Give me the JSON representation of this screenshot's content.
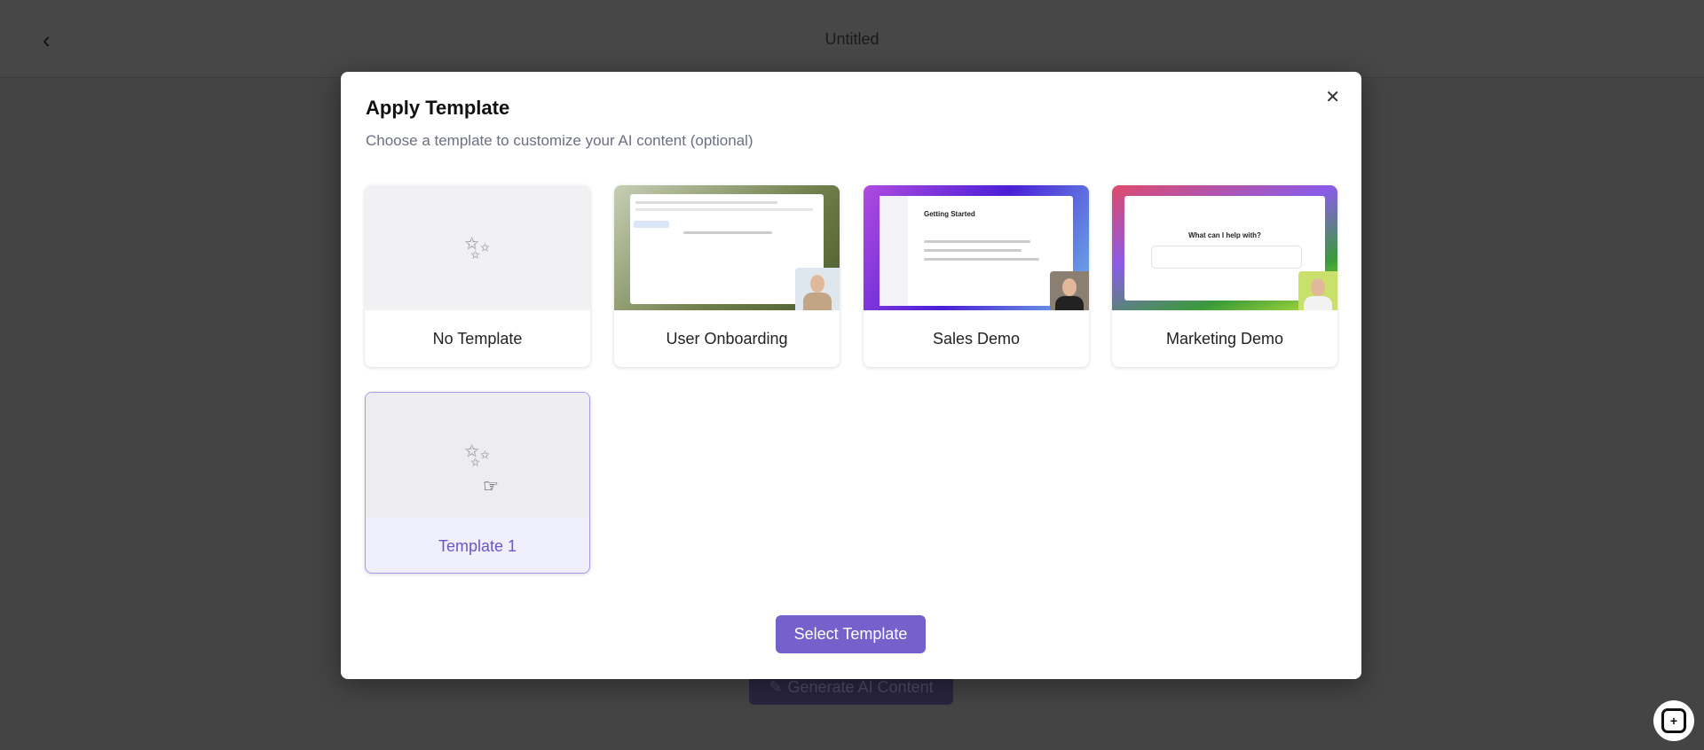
{
  "page": {
    "title": "Untitled",
    "generate_label": "Generate AI Content"
  },
  "modal": {
    "title": "Apply Template",
    "subtitle": "Choose a template to customize your AI content (optional)",
    "templates": [
      {
        "label": "No Template"
      },
      {
        "label": "User Onboarding"
      },
      {
        "label": "Sales Demo"
      },
      {
        "label": "Marketing Demo"
      },
      {
        "label": "Template 1",
        "selected": true
      }
    ],
    "sales_thumb_heading": "Getting Started",
    "marketing_thumb_heading": "What can I help with?",
    "select_label": "Select Template"
  },
  "colors": {
    "accent": "#7561cc",
    "overlay": "#444444"
  }
}
